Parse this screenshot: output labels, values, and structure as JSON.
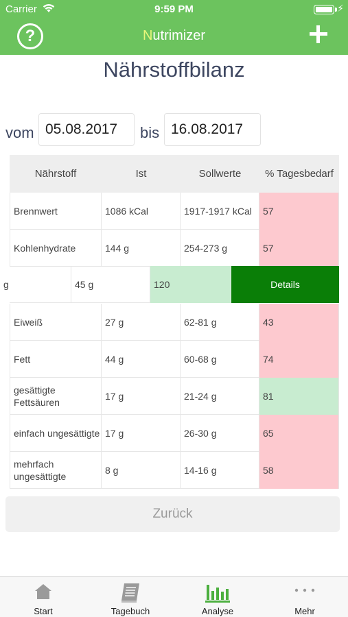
{
  "status_bar": {
    "carrier": "Carrier",
    "time": "9:59 PM"
  },
  "nav": {
    "title_first": "N",
    "title_rest": "utrimizer"
  },
  "page": {
    "title": "Nährstoffbilanz"
  },
  "date_range": {
    "from_label": "vom",
    "from_value": "05.08.2017",
    "to_label": "bis",
    "to_value": "16.08.2017"
  },
  "table": {
    "headers": [
      "Nährstoff",
      "Ist",
      "Sollwerte",
      "% Tagesbedarf"
    ],
    "rows": [
      {
        "name": "Brennwert",
        "ist": "1086 kCal",
        "soll": "1917-1917 kCal",
        "percent": "57",
        "status": "red"
      },
      {
        "name": "Kohlenhydrate",
        "ist": "144 g",
        "soll": "254-273 g",
        "percent": "57",
        "status": "red"
      },
      {
        "name": "Eiweiß",
        "ist": "27 g",
        "soll": "62-81 g",
        "percent": "43",
        "status": "red"
      },
      {
        "name": "Fett",
        "ist": "44 g",
        "soll": "60-68 g",
        "percent": "74",
        "status": "red"
      },
      {
        "name": "gesättigte Fettsäuren",
        "ist": "17 g",
        "soll": "21-24 g",
        "percent": "81",
        "status": "green"
      },
      {
        "name": "einfach ungesättigte",
        "ist": "17 g",
        "soll": "26-30 g",
        "percent": "65",
        "status": "red"
      },
      {
        "name": "mehrfach ungesättigte",
        "ist": "8 g",
        "soll": "14-16 g",
        "percent": "58",
        "status": "red"
      }
    ],
    "swiped_row": {
      "name": "g",
      "ist": "45 g",
      "percent": "120",
      "action": "Details"
    }
  },
  "back_button": "Zurück",
  "tabs": [
    {
      "label": "Start",
      "icon": "home-icon"
    },
    {
      "label": "Tagebuch",
      "icon": "book-icon"
    },
    {
      "label": "Analyse",
      "icon": "bar-chart-icon",
      "active": true
    },
    {
      "label": "Mehr",
      "icon": "more-icon"
    }
  ],
  "colors": {
    "brand": "#6cc35e",
    "bad": "#fdc9cf",
    "good": "#c8ecd0",
    "action": "#0a7e07"
  }
}
